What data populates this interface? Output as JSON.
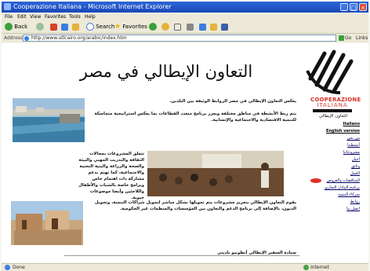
{
  "window": {
    "title": "Cooperazione Italiana - Microsoft Internet Explorer",
    "controls": [
      "_",
      "□",
      "×"
    ]
  },
  "menu": [
    "File",
    "Edit",
    "View",
    "Favorites",
    "Tools",
    "Help"
  ],
  "toolbar": {
    "back_label": "Back",
    "search_label": "Search",
    "favorites_label": "Favorites"
  },
  "address": {
    "label": "Address",
    "url": "http://www.utlcairo.org/arabic/index.htm",
    "go_label": "Go",
    "links_label": "Links"
  },
  "page": {
    "heading": "التعاون الإيطالي في مصر",
    "logo": {
      "line1": "COOPERAZIONE",
      "line2": "ITALIANA"
    },
    "sidebar_title": "التعاون الإيطالي",
    "nav": [
      "Italiano",
      "English version",
      "من نحن",
      "أنشطتنا",
      "مشروعاتنا",
      "أخبار",
      "وثائق",
      "العمل",
      "المناقصات والعروض",
      "برنامج التبادل التجاري",
      "شركاء التنمية",
      "روابط",
      "اتصل بنا"
    ],
    "paragraphs": [
      "يعكس التعاون الإيطالي في مصر الروابط الوثيقة بين البلدين.",
      "يتم ربط الأنشطة في مناطق مختلفة ويعزز برنامج متعدد القطاعات بما يعكس استراتيجية متماسكة للتنمية الاقتصادية والاجتماعية والإنسانية.",
      "تتعلق المشروعات بمجالات الثقافة والتدريب المهني والبيئة والصحة والزراعة والبنية التحتية والاجتماعية، كما تهتم بدعم مشاركة ذات اهتمام خاص وبرامج خاصة بالشباب والأطفال واللاجئين وأيضا موضوعات حيوية.",
      "يقوم التعاون الإيطالي بتعزيز مشروعات يتم تمويلها بشكل مباشر لتمويل شراكات التنمية، وتحويل الديون، بالإضافة إلى برنامج الدعم والتعاون بين المؤسسات والمنظمات غير الحكومية.",
      "سيادة السفير الإيطالي أنطونيو باديني"
    ]
  },
  "status": {
    "text": "Done",
    "zone": "Internet"
  }
}
